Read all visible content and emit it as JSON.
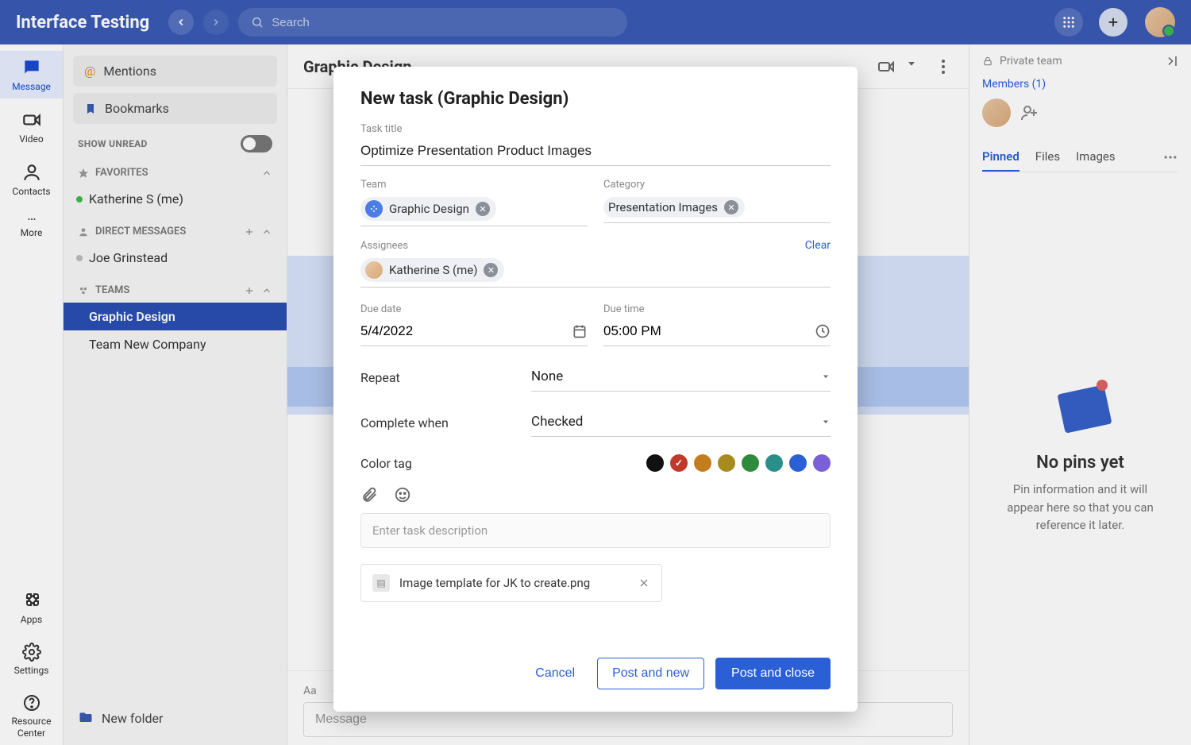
{
  "app": {
    "title": "Interface Testing",
    "search_placeholder": "Search"
  },
  "rail": {
    "message": "Message",
    "video": "Video",
    "contacts": "Contacts",
    "more": "More",
    "apps": "Apps",
    "settings": "Settings",
    "resource_center": "Resource Center"
  },
  "sidebar": {
    "mentions": "Mentions",
    "bookmarks": "Bookmarks",
    "show_unread": "SHOW UNREAD",
    "favorites": "FAVORITES",
    "favorites_items": [
      "Katherine S (me)"
    ],
    "direct_messages": "DIRECT MESSAGES",
    "direct_messages_items": [
      "Joe Grinstead"
    ],
    "teams": "TEAMS",
    "teams_items": [
      "Graphic Design",
      "Team New Company"
    ],
    "new_folder": "New folder"
  },
  "chat": {
    "title": "Graphic Design",
    "composer_placeholder": "Message"
  },
  "rightpanel": {
    "private_team": "Private team",
    "members_link": "Members (1)",
    "tabs": [
      "Pinned",
      "Files",
      "Images"
    ],
    "nopins_title": "No pins yet",
    "nopins_body": "Pin information and it will appear here so that you can reference it later."
  },
  "modal": {
    "title": "New task (Graphic Design)",
    "task_title_label": "Task title",
    "task_title_value": "Optimize Presentation Product Images",
    "team_label": "Team",
    "team_value": "Graphic Design",
    "category_label": "Category",
    "category_value": "Presentation Images",
    "assignees_label": "Assignees",
    "assignees_value": "Katherine S (me)",
    "clear": "Clear",
    "due_date_label": "Due date",
    "due_date_value": "5/4/2022",
    "due_time_label": "Due time",
    "due_time_value": "05:00 PM",
    "repeat_label": "Repeat",
    "repeat_value": "None",
    "complete_label": "Complete when",
    "complete_value": "Checked",
    "color_tag_label": "Color tag",
    "colors": [
      "#111111",
      "#c0392b",
      "#c37c1e",
      "#a88b1f",
      "#2e8b3e",
      "#2a8f8a",
      "#2a5fd6",
      "#7a5fd6"
    ],
    "selected_color_index": 1,
    "desc_placeholder": "Enter task description",
    "attachment_name": "Image template for JK to create.png",
    "cancel": "Cancel",
    "post_and_new": "Post and new",
    "post_and_close": "Post and close"
  }
}
